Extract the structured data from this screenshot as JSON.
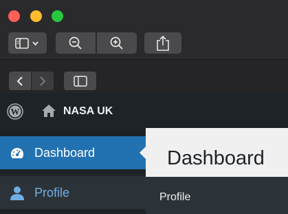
{
  "window": {
    "traffic_lights": [
      "close",
      "minimize",
      "zoom"
    ],
    "toolbar_icons": [
      "sidebar-icon",
      "chevron-down-icon",
      "zoom-out-icon",
      "zoom-in-icon",
      "share-icon"
    ],
    "nav_icons": [
      "back-icon",
      "forward-icon",
      "sidebar-toggle-icon"
    ]
  },
  "adminbar": {
    "site_name": "NASA UK"
  },
  "sidebar": {
    "items": [
      {
        "label": "Dashboard",
        "icon": "dashboard-icon",
        "active": true
      },
      {
        "label": "Profile",
        "icon": "user-icon",
        "active": false
      }
    ]
  },
  "content": {
    "title": "Dashboard",
    "submenu": [
      "Profile"
    ]
  },
  "colors": {
    "active": "#2271b1",
    "link": "#72aee6",
    "adminbar": "#1d2327"
  }
}
